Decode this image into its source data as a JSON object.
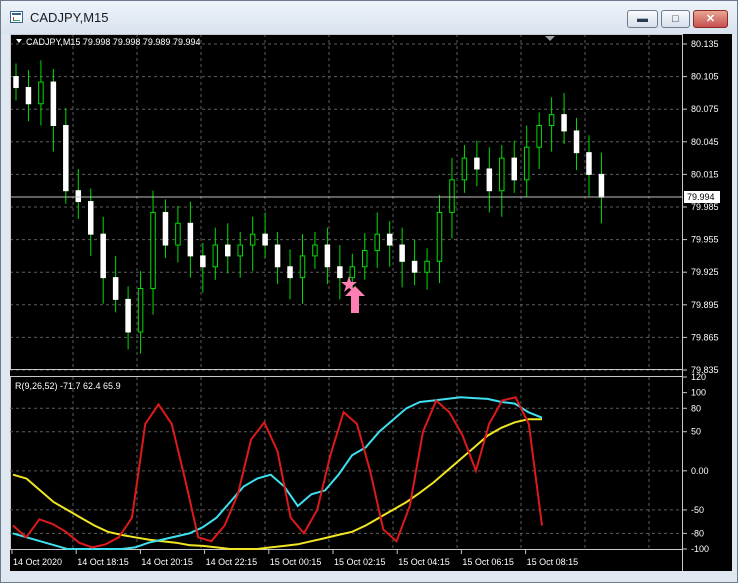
{
  "window": {
    "title": "CADJPY,M15",
    "minimize_label": "▬",
    "maximize_label": "□",
    "close_label": "✕"
  },
  "main_chart": {
    "info": "CADJPY,M15  79.998 79.998 79.989 79.994",
    "current_price_label": "79.994",
    "arrow_color": "#ff7eb4",
    "y_ticks": [
      "80.135",
      "80.105",
      "80.075",
      "80.045",
      "80.015",
      "79.985",
      "79.955",
      "79.925",
      "79.895",
      "79.865",
      "79.835"
    ]
  },
  "indicator": {
    "info": "R(9,26,52) -71.7 62.4 65.9",
    "y_ticks": [
      "120",
      "100",
      "80",
      "50",
      "0.00",
      "-50",
      "-80",
      "-100"
    ]
  },
  "x_axis": {
    "labels": [
      "14 Oct 2020",
      "14 Oct 18:15",
      "14 Oct 20:15",
      "14 Oct 22:15",
      "15 Oct 00:15",
      "15 Oct 02:15",
      "15 Oct 04:15",
      "15 Oct 06:15",
      "15 Oct 08:15"
    ]
  },
  "chart_data": [
    {
      "type": "candlestick",
      "title": "CADJPY,M15",
      "ylim": [
        79.835,
        80.135
      ],
      "approx_closes": [
        80.095,
        80.08,
        80.1,
        80.06,
        80.0,
        79.99,
        79.96,
        79.92,
        79.9,
        79.87,
        79.91,
        79.98,
        79.95,
        79.97,
        79.94,
        79.93,
        79.95,
        79.94,
        79.95,
        79.96,
        79.95,
        79.93,
        79.92,
        79.94,
        79.95,
        79.93,
        79.92,
        79.93,
        79.945,
        79.96,
        79.95,
        79.935,
        79.925,
        79.935,
        79.98,
        80.01,
        80.03,
        80.02,
        80.0,
        80.03,
        80.01,
        80.04,
        80.06,
        80.07,
        80.055,
        80.035,
        80.015,
        79.994
      ],
      "grid": true,
      "annotations": [
        "star",
        "up-arrow"
      ]
    },
    {
      "type": "line",
      "title": "R(9,26,52)",
      "ylim": [
        -100,
        120
      ],
      "series": [
        {
          "color": "#dd1a1a",
          "values": [
            -70,
            -85,
            -62,
            -68,
            -78,
            -92,
            -98,
            -94,
            -85,
            -60,
            60,
            85,
            60,
            -10,
            -85,
            -90,
            -70,
            -30,
            40,
            62,
            25,
            -60,
            -80,
            -50,
            20,
            75,
            60,
            0,
            -75,
            -90,
            -45,
            50,
            90,
            75,
            45,
            0,
            60,
            90,
            94,
            60,
            -70
          ]
        },
        {
          "color": "#3ee0f0",
          "values": [
            -80,
            -85,
            -90,
            -95,
            -100,
            -100,
            -100,
            -100,
            -100,
            -98,
            -92,
            -88,
            -84,
            -80,
            -72,
            -60,
            -40,
            -20,
            -10,
            -5,
            -20,
            -45,
            -30,
            -25,
            -5,
            20,
            30,
            50,
            65,
            80,
            88,
            90,
            92,
            94,
            93,
            92,
            88,
            86,
            75,
            68
          ]
        },
        {
          "color": "#f0e622",
          "values": [
            -5,
            -10,
            -25,
            -40,
            -50,
            -60,
            -70,
            -78,
            -82,
            -85,
            -88,
            -90,
            -92,
            -95,
            -96,
            -98,
            -100,
            -100,
            -100,
            -98,
            -96,
            -94,
            -90,
            -86,
            -82,
            -78,
            -70,
            -60,
            -50,
            -40,
            -28,
            -15,
            0,
            15,
            30,
            45,
            55,
            62,
            66,
            66
          ]
        }
      ]
    }
  ]
}
